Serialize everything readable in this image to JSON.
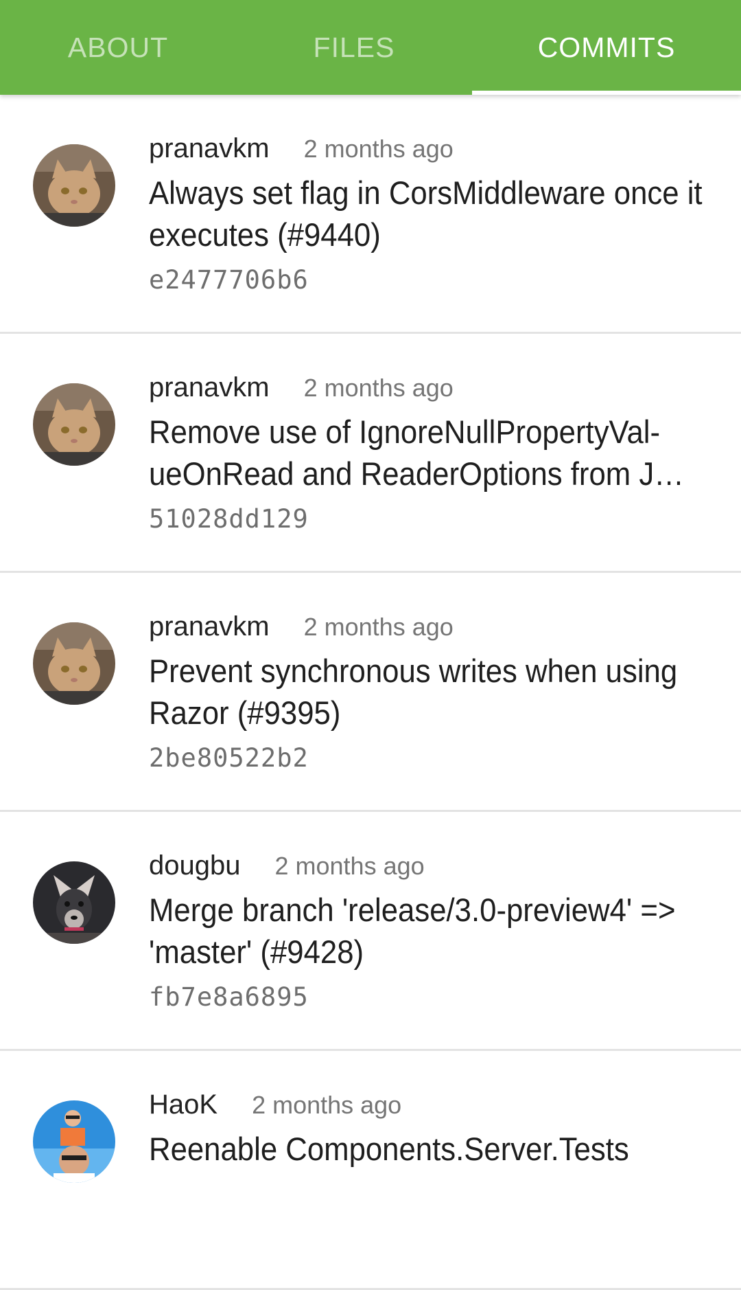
{
  "tabs": [
    {
      "label": "ABOUT"
    },
    {
      "label": "FILES"
    },
    {
      "label": "COMMITS"
    }
  ],
  "commits": [
    {
      "author": "pranavkm",
      "time": "2 months ago",
      "message": "Always set flag in CorsMiddleware once it executes (#9440)",
      "sha": "e2477706b6",
      "avatar": "cat-avatar"
    },
    {
      "author": "pranavkm",
      "time": "2 months ago",
      "message": "Remove use of IgnoreNullPropertyVal-ueOnRead and ReaderOptions from J…",
      "sha": "51028dd129",
      "avatar": "cat-avatar"
    },
    {
      "author": "pranavkm",
      "time": "2 months ago",
      "message": "Prevent synchronous writes when using Razor (#9395)",
      "sha": "2be80522b2",
      "avatar": "cat-avatar"
    },
    {
      "author": "dougbu",
      "time": "2 months ago",
      "message": "Merge branch 'release/3.0-preview4' => 'master' (#9428)",
      "sha": "fb7e8a6895",
      "avatar": "dog-avatar"
    },
    {
      "author": "HaoK",
      "time": "2 months ago",
      "message": "Reenable Components.Server.Tests",
      "sha": "",
      "avatar": "person-avatar"
    }
  ],
  "colors": {
    "accent": "#6ab446",
    "divider": "#e3e3e3"
  }
}
